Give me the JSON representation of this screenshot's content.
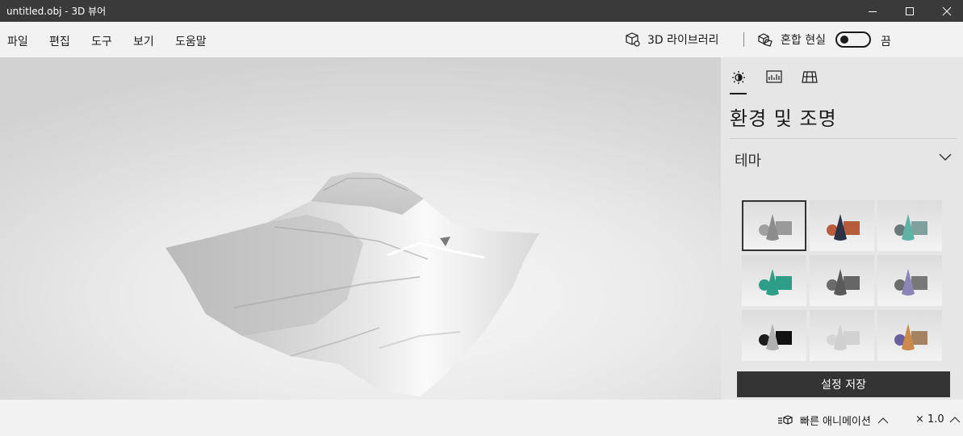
{
  "window": {
    "title": "untitled.obj - 3D 뷰어"
  },
  "menu": {
    "items": [
      {
        "label": "파일",
        "name": "menu-file"
      },
      {
        "label": "편집",
        "name": "menu-edit"
      },
      {
        "label": "도구",
        "name": "menu-tools"
      },
      {
        "label": "보기",
        "name": "menu-view"
      },
      {
        "label": "도움말",
        "name": "menu-help"
      }
    ],
    "library_label": "3D 라이브러리",
    "mixed_reality_label": "혼합 현실",
    "toggle_state": "끔"
  },
  "panel": {
    "tabs": [
      "environment-lighting-tab",
      "stats-tab",
      "grid-tab"
    ],
    "title": "환경 및 조명",
    "theme_label": "테마",
    "save_label": "설정 저장",
    "themes": [
      {
        "cone": "#8c8c8c",
        "sphere": "#a0a0a0",
        "box": "#9a9a9a"
      },
      {
        "cone": "#2e3247",
        "sphere": "#b85c3c",
        "box": "#b55b3a"
      },
      {
        "cone": "#5fb3a4",
        "sphere": "#6a7a78",
        "box": "#7fa09c"
      },
      {
        "cone": "#2f9e86",
        "sphere": "#2f9e86",
        "box": "#2f9e86"
      },
      {
        "cone": "#5a5a5a",
        "sphere": "#6b6b6b",
        "box": "#666666"
      },
      {
        "cone": "#8a85b5",
        "sphere": "#6c6c6c",
        "box": "#787878"
      },
      {
        "cone": "#b0b0b0",
        "sphere": "#1c1c1c",
        "box": "#111111"
      },
      {
        "cone": "#d0d0d0",
        "sphere": "#d6d6d6",
        "box": "#d2d2d2"
      },
      {
        "cone": "#c98a4c",
        "sphere": "#6a5fa0",
        "box": "#a58262"
      }
    ]
  },
  "status": {
    "animation_label": "빠른 애니메이션",
    "zoom_label": "× 1.0"
  }
}
